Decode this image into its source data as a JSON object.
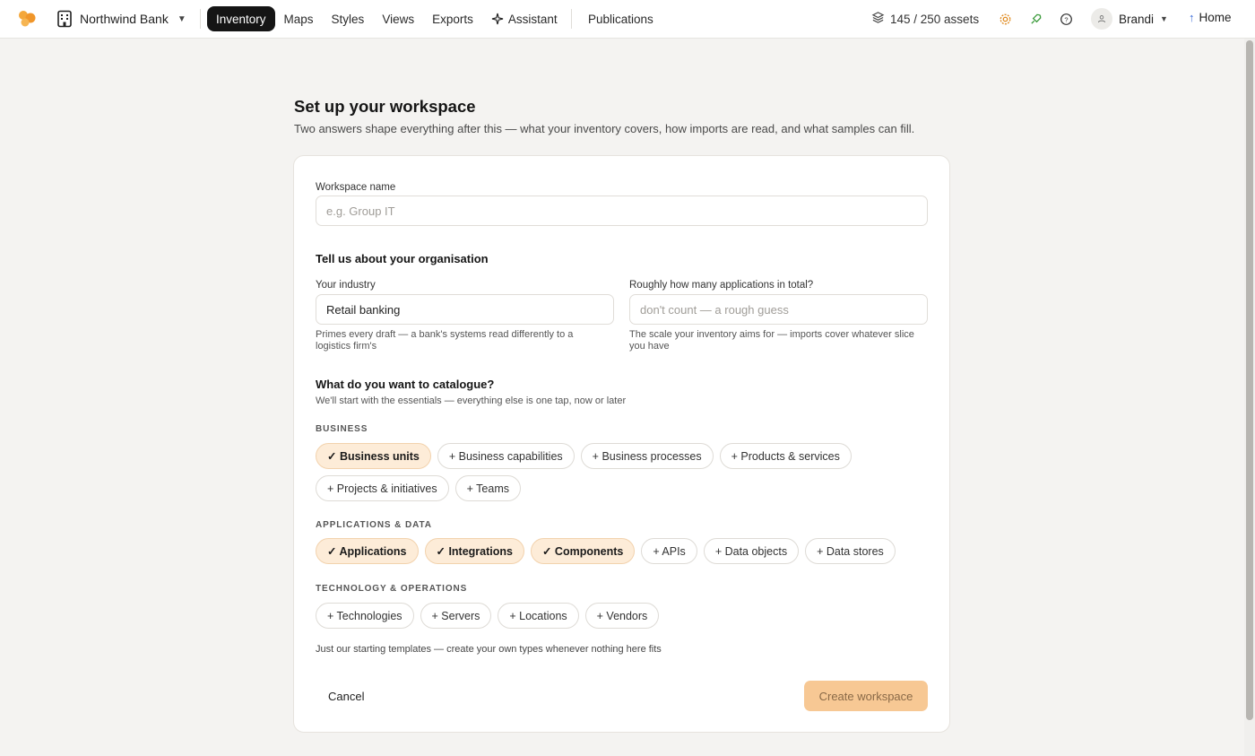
{
  "topbar": {
    "org_name": "Northwind Bank",
    "nav": [
      "Inventory",
      "Maps",
      "Styles",
      "Views",
      "Exports",
      "Assistant"
    ],
    "publications": "Publications",
    "assets": "145 / 250  assets",
    "user": "Brandi",
    "home": "Home"
  },
  "page": {
    "title": "Set up your workspace",
    "subtitle": "Two answers shape everything after this — what your inventory covers, how imports are read, and what samples can fill."
  },
  "form": {
    "workspace_label": "Workspace name",
    "workspace_placeholder": "e.g. Group IT",
    "org_title": "Tell us about your organisation",
    "industry_label": "Your industry",
    "industry_value": "Retail banking",
    "industry_hint": "Primes every draft — a bank's systems read differently to a logistics firm's",
    "apps_label": "Roughly how many applications in total?",
    "apps_placeholder": "don't count — a rough guess",
    "apps_hint": "The scale your inventory aims for — imports cover whatever slice you have",
    "catalogue_title": "What do you want to catalogue?",
    "catalogue_sub": "We'll start with the essentials — everything else is one tap, now or later",
    "groups": [
      {
        "label": "BUSINESS",
        "chips": [
          {
            "text": "✓ Business units",
            "on": true
          },
          {
            "text": "+ Business capabilities",
            "on": false
          },
          {
            "text": "+ Business processes",
            "on": false
          },
          {
            "text": "+ Products & services",
            "on": false
          },
          {
            "text": "+ Projects & initiatives",
            "on": false
          },
          {
            "text": "+ Teams",
            "on": false
          }
        ]
      },
      {
        "label": "APPLICATIONS & DATA",
        "chips": [
          {
            "text": "✓ Applications",
            "on": true
          },
          {
            "text": "✓ Integrations",
            "on": true
          },
          {
            "text": "✓ Components",
            "on": true
          },
          {
            "text": "+ APIs",
            "on": false
          },
          {
            "text": "+ Data objects",
            "on": false
          },
          {
            "text": "+ Data stores",
            "on": false
          }
        ]
      },
      {
        "label": "TECHNOLOGY & OPERATIONS",
        "chips": [
          {
            "text": "+ Technologies",
            "on": false
          },
          {
            "text": "+ Servers",
            "on": false
          },
          {
            "text": "+ Locations",
            "on": false
          },
          {
            "text": "+ Vendors",
            "on": false
          }
        ]
      }
    ],
    "footnote": "Just our starting templates — create your own types whenever nothing here fits",
    "cancel": "Cancel",
    "create": "Create workspace"
  },
  "colors": {
    "accent": "#f7c894",
    "chip_selected": "#fdecd8",
    "nav_active": "#151515"
  }
}
